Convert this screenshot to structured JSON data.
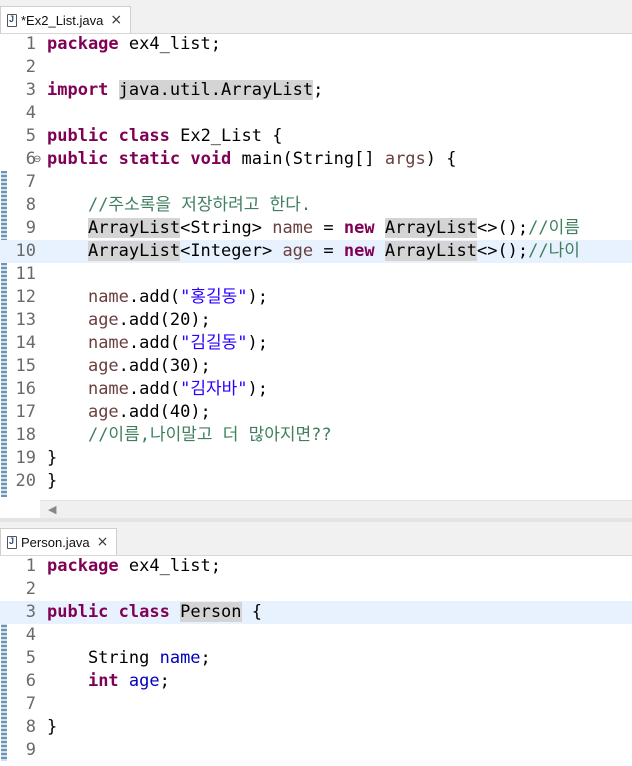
{
  "editor1": {
    "tab": {
      "label": "*Ex2_List.java",
      "close": "×"
    },
    "lines": [
      {
        "num": "1",
        "tokens": [
          {
            "t": "package",
            "c": "kw"
          },
          {
            "t": " ex4_list;",
            "c": ""
          }
        ]
      },
      {
        "num": "2",
        "tokens": []
      },
      {
        "num": "3",
        "tokens": [
          {
            "t": "import",
            "c": "kw"
          },
          {
            "t": " ",
            "c": ""
          },
          {
            "t": "java.util.ArrayList",
            "c": "occ"
          },
          {
            "t": ";",
            "c": ""
          }
        ]
      },
      {
        "num": "4",
        "tokens": []
      },
      {
        "num": "5",
        "tokens": [
          {
            "t": "public",
            "c": "kw"
          },
          {
            "t": " ",
            "c": ""
          },
          {
            "t": "class",
            "c": "kw"
          },
          {
            "t": " Ex2_List {",
            "c": ""
          }
        ]
      },
      {
        "num": "6",
        "fold": "⊖",
        "tokens": [
          {
            "t": "public",
            "c": "kw"
          },
          {
            "t": " ",
            "c": ""
          },
          {
            "t": "static",
            "c": "kw"
          },
          {
            "t": " ",
            "c": ""
          },
          {
            "t": "void",
            "c": "kw"
          },
          {
            "t": " main(String[] ",
            "c": ""
          },
          {
            "t": "args",
            "c": "var"
          },
          {
            "t": ") {",
            "c": ""
          }
        ]
      },
      {
        "num": "7",
        "tokens": []
      },
      {
        "num": "8",
        "tokens": [
          {
            "t": "    ",
            "c": ""
          },
          {
            "t": "//주소록을 저장하려고 한다.",
            "c": "cm"
          }
        ]
      },
      {
        "num": "9",
        "tokens": [
          {
            "t": "    ",
            "c": ""
          },
          {
            "t": "ArrayList",
            "c": "occ"
          },
          {
            "t": "<String> ",
            "c": ""
          },
          {
            "t": "name",
            "c": "var"
          },
          {
            "t": " = ",
            "c": ""
          },
          {
            "t": "new",
            "c": "kw"
          },
          {
            "t": " ",
            "c": ""
          },
          {
            "t": "ArrayList",
            "c": "occ"
          },
          {
            "t": "<>();",
            "c": ""
          },
          {
            "t": "//이름",
            "c": "cm"
          }
        ]
      },
      {
        "num": "10",
        "hl": true,
        "tokens": [
          {
            "t": "    ",
            "c": ""
          },
          {
            "t": "ArrayList",
            "c": "occ"
          },
          {
            "t": "<Integer> ",
            "c": ""
          },
          {
            "t": "age",
            "c": "var"
          },
          {
            "t": " = ",
            "c": ""
          },
          {
            "t": "new",
            "c": "kw"
          },
          {
            "t": " ",
            "c": ""
          },
          {
            "t": "ArrayList",
            "c": "occ"
          },
          {
            "t": "<>();",
            "c": ""
          },
          {
            "t": "//나이",
            "c": "cm"
          }
        ]
      },
      {
        "num": "11",
        "tokens": []
      },
      {
        "num": "12",
        "tokens": [
          {
            "t": "    ",
            "c": ""
          },
          {
            "t": "name",
            "c": "var"
          },
          {
            "t": ".add(",
            "c": ""
          },
          {
            "t": "\"홍길동\"",
            "c": "st"
          },
          {
            "t": ");",
            "c": ""
          }
        ]
      },
      {
        "num": "13",
        "tokens": [
          {
            "t": "    ",
            "c": ""
          },
          {
            "t": "age",
            "c": "var"
          },
          {
            "t": ".add(20);",
            "c": ""
          }
        ]
      },
      {
        "num": "14",
        "tokens": [
          {
            "t": "    ",
            "c": ""
          },
          {
            "t": "name",
            "c": "var"
          },
          {
            "t": ".add(",
            "c": ""
          },
          {
            "t": "\"김길동\"",
            "c": "st"
          },
          {
            "t": ");",
            "c": ""
          }
        ]
      },
      {
        "num": "15",
        "tokens": [
          {
            "t": "    ",
            "c": ""
          },
          {
            "t": "age",
            "c": "var"
          },
          {
            "t": ".add(30);",
            "c": ""
          }
        ]
      },
      {
        "num": "16",
        "tokens": [
          {
            "t": "    ",
            "c": ""
          },
          {
            "t": "name",
            "c": "var"
          },
          {
            "t": ".add(",
            "c": ""
          },
          {
            "t": "\"김자바\"",
            "c": "st"
          },
          {
            "t": ");",
            "c": ""
          }
        ]
      },
      {
        "num": "17",
        "tokens": [
          {
            "t": "    ",
            "c": ""
          },
          {
            "t": "age",
            "c": "var"
          },
          {
            "t": ".add(40);",
            "c": ""
          }
        ]
      },
      {
        "num": "18",
        "tokens": [
          {
            "t": "    ",
            "c": ""
          },
          {
            "t": "//이름,나이말고 더 많아지면??",
            "c": "cm"
          }
        ]
      },
      {
        "num": "19",
        "tokens": [
          {
            "t": "}",
            "c": ""
          }
        ]
      },
      {
        "num": "20",
        "tokens": [
          {
            "t": "}",
            "c": ""
          }
        ]
      }
    ]
  },
  "editor2": {
    "tab": {
      "label": "Person.java",
      "close": "×"
    },
    "lines": [
      {
        "num": "1",
        "tokens": [
          {
            "t": "package",
            "c": "kw"
          },
          {
            "t": " ex4_list;",
            "c": ""
          }
        ]
      },
      {
        "num": "2",
        "tokens": []
      },
      {
        "num": "3",
        "hl": true,
        "tokens": [
          {
            "t": "public",
            "c": "kw"
          },
          {
            "t": " ",
            "c": ""
          },
          {
            "t": "class",
            "c": "kw"
          },
          {
            "t": " ",
            "c": ""
          },
          {
            "t": "Person",
            "c": "occ"
          },
          {
            "t": " {",
            "c": ""
          }
        ]
      },
      {
        "num": "4",
        "tokens": []
      },
      {
        "num": "5",
        "tokens": [
          {
            "t": "    String ",
            "c": ""
          },
          {
            "t": "name",
            "c": "fld"
          },
          {
            "t": ";",
            "c": ""
          }
        ]
      },
      {
        "num": "6",
        "tokens": [
          {
            "t": "    ",
            "c": ""
          },
          {
            "t": "int",
            "c": "kw"
          },
          {
            "t": " ",
            "c": ""
          },
          {
            "t": "age",
            "c": "fld"
          },
          {
            "t": ";",
            "c": ""
          }
        ]
      },
      {
        "num": "7",
        "tokens": []
      },
      {
        "num": "8",
        "tokens": [
          {
            "t": "}",
            "c": ""
          }
        ]
      },
      {
        "num": "9",
        "tokens": []
      }
    ]
  }
}
